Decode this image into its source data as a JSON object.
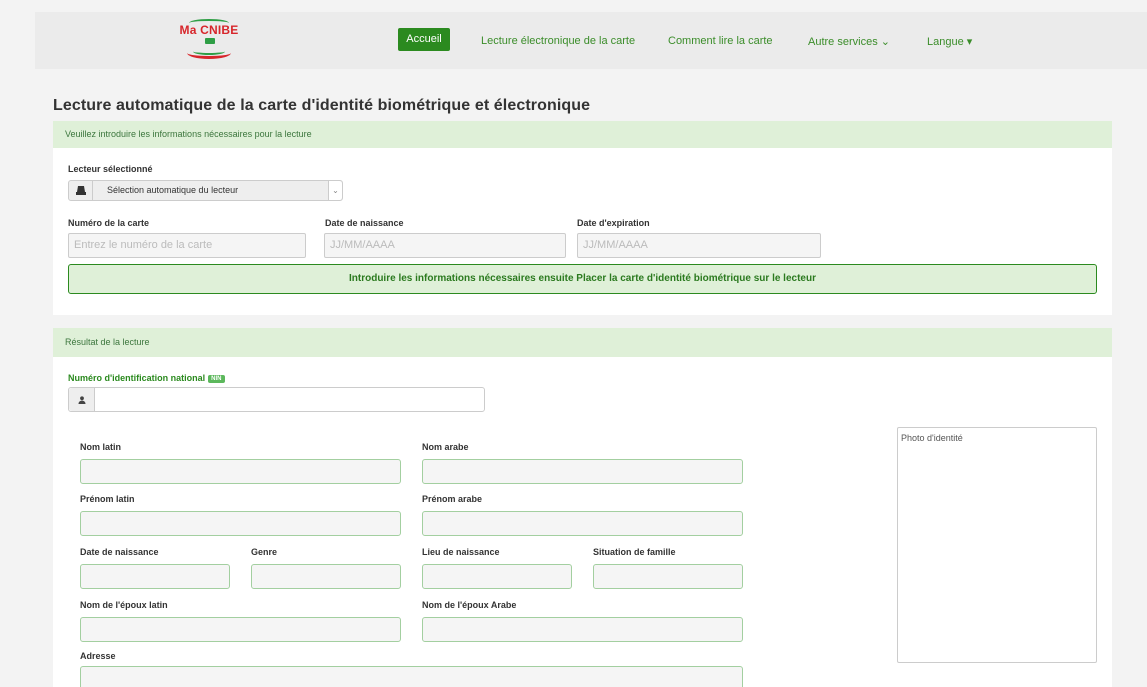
{
  "nav": {
    "logo_text": "Ma CNIBE",
    "items": [
      {
        "label": "Accueil",
        "active": true
      },
      {
        "label": "Lecture électronique de la carte"
      },
      {
        "label": "Comment lire la carte"
      },
      {
        "label": "Autre services ⌄"
      },
      {
        "label": "Langue ▾"
      }
    ]
  },
  "page_title": "Lecture automatique de la carte d'identité biométrique et électronique",
  "input_panel": {
    "heading": "Veuillez introduire les informations nécessaires pour la lecture",
    "reader_label": "Lecteur sélectionné",
    "reader_value": "Sélection automatique du lecteur",
    "card_number_label": "Numéro de la carte",
    "card_number_placeholder": "Entrez le numéro de la carte",
    "birth_date_label": "Date de naissance",
    "birth_date_placeholder": "JJ/MM/AAAA",
    "expiry_date_label": "Date d'expiration",
    "expiry_date_placeholder": "JJ/MM/AAAA",
    "alert_text": "Introduire les informations nécessaires ensuite Placer la carte d'identité biométrique sur le lecteur"
  },
  "result_panel": {
    "heading": "Résultat de la lecture",
    "nin_label": "Numéro d'identification national",
    "nin_badge": "NIN",
    "nin_value": "",
    "photo_label": "Photo d'identité",
    "fields": {
      "nom_latin": "Nom latin",
      "nom_arabe": "Nom arabe",
      "prenom_latin": "Prénom latin",
      "prenom_arabe": "Prénom arabe",
      "date_naissance": "Date de naissance",
      "genre": "Genre",
      "lieu_naissance": "Lieu de naissance",
      "situation_famille": "Situation de famille",
      "epoux_latin": "Nom de l'époux latin",
      "epoux_arabe": "Nom de l'époux Arabe",
      "adresse": "Adresse"
    }
  },
  "colors": {
    "brand_green": "#2b8a1f",
    "panel_head_bg": "#dff0d8",
    "logo_red": "#d7262b"
  }
}
